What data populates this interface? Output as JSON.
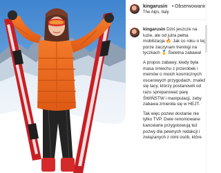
{
  "post": {
    "username": "kingarusin",
    "follow_separator": "•",
    "follow_label": "Obserwowanie",
    "location": "The Alps, Italy"
  },
  "caption": {
    "username": "kingarusin",
    "paragraph_1": "Dziś jeszcze na luzie, ale od jutra pełna mobilizacja 🔥 Jak co roku o tej porze zaczynam treningi na tyczkach 🥇 Świetna zabawa!",
    "paragraph_2": "A propos zabawy, kiedy była masa śmiechu z przerobek i memów o moich kosmicznych oscarowych przygodach, znaleźli się tacy, którzy postanowili od razu spreparować parę ŚWIŃSTW i manipulacji, żeby zabawa zmieniła się w HEJT.",
    "paragraph_3": "Tak więc pozew dostanie nie tylko TVP. Dwie renomowane kancelarie przygotowują też pozwy dla pewnych redakcji i związanych z nimi osób, które"
  },
  "colors": {
    "accent_jacket": "#f06a1e",
    "ski_red": "#d42a2a",
    "sky": "#4e8fd0",
    "text": "#262626"
  }
}
